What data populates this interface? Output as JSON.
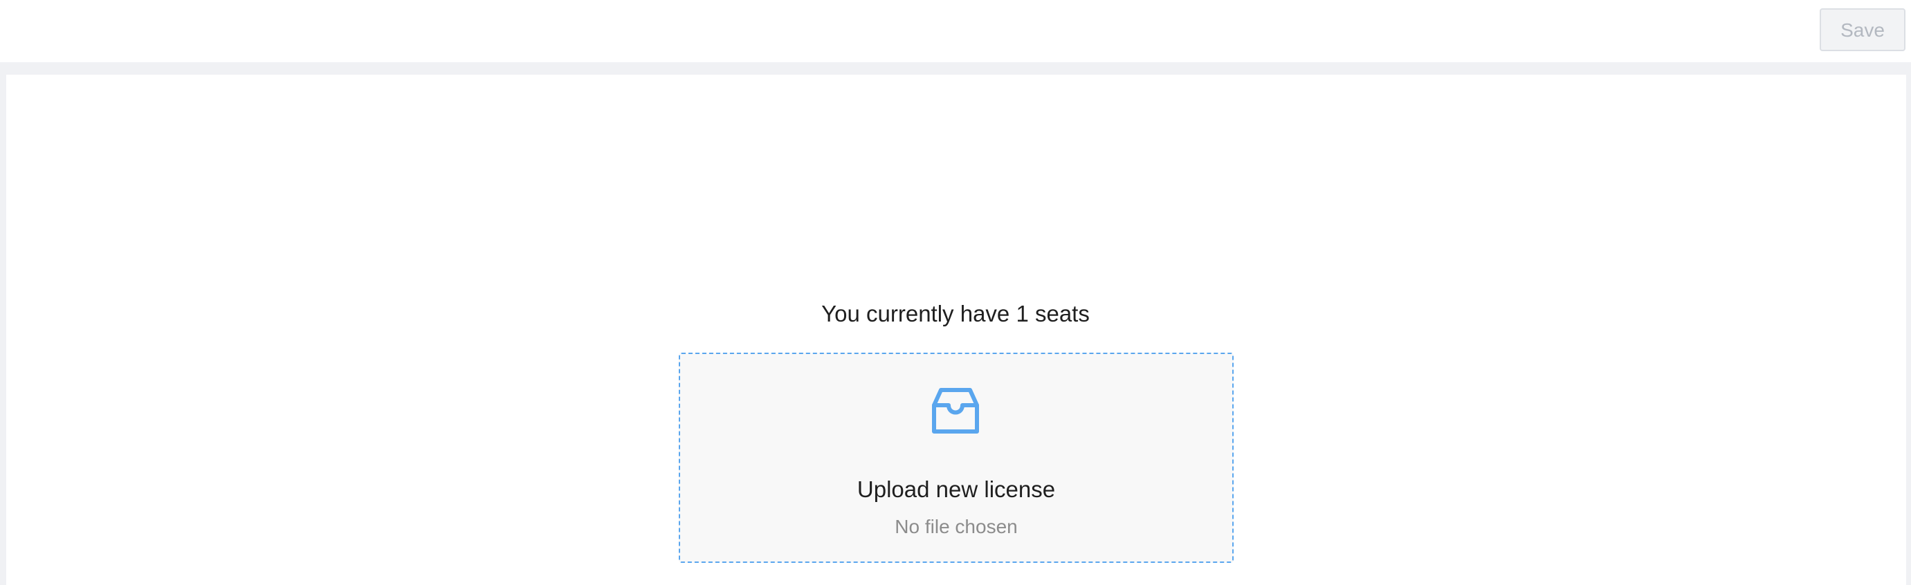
{
  "toolbar": {
    "save_label": "Save"
  },
  "license": {
    "seats_text": "You currently have 1 seats",
    "upload_title": "Upload new license",
    "file_status": "No file chosen",
    "icon": "inbox-icon"
  },
  "colors": {
    "accent": "#5aa6ee",
    "dropzone_background": "#f8f8f8",
    "page_background": "#f0f1f4"
  }
}
